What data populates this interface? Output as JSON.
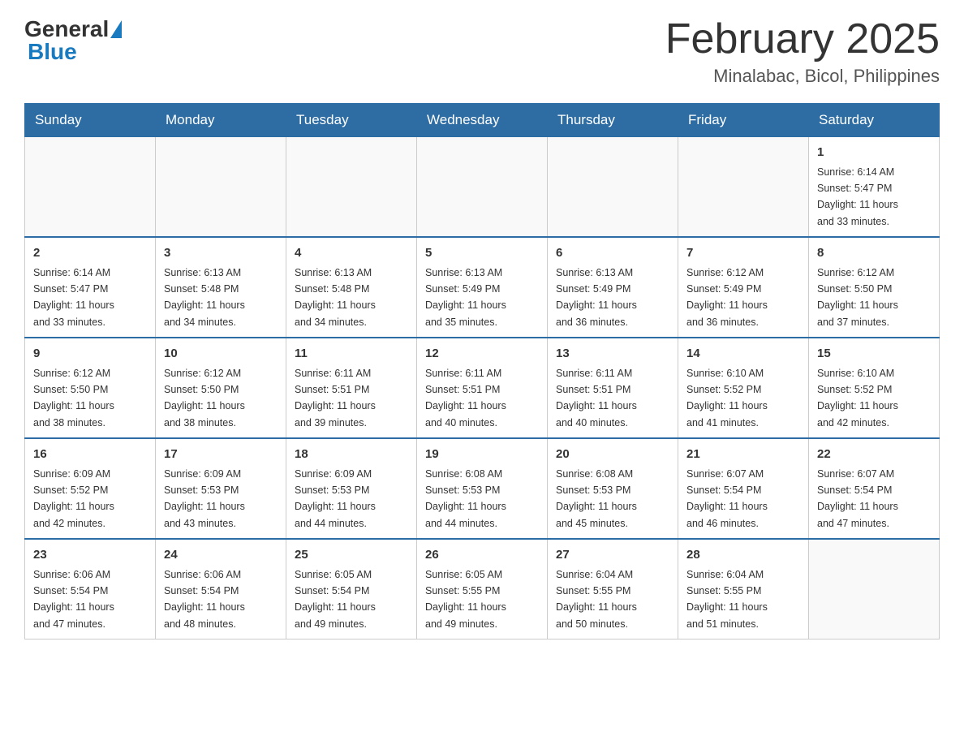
{
  "header": {
    "logo_general": "General",
    "logo_blue": "Blue",
    "main_title": "February 2025",
    "subtitle": "Minalabac, Bicol, Philippines"
  },
  "days_of_week": [
    "Sunday",
    "Monday",
    "Tuesday",
    "Wednesday",
    "Thursday",
    "Friday",
    "Saturday"
  ],
  "weeks": [
    [
      {
        "day": "",
        "info": ""
      },
      {
        "day": "",
        "info": ""
      },
      {
        "day": "",
        "info": ""
      },
      {
        "day": "",
        "info": ""
      },
      {
        "day": "",
        "info": ""
      },
      {
        "day": "",
        "info": ""
      },
      {
        "day": "1",
        "info": "Sunrise: 6:14 AM\nSunset: 5:47 PM\nDaylight: 11 hours\nand 33 minutes."
      }
    ],
    [
      {
        "day": "2",
        "info": "Sunrise: 6:14 AM\nSunset: 5:47 PM\nDaylight: 11 hours\nand 33 minutes."
      },
      {
        "day": "3",
        "info": "Sunrise: 6:13 AM\nSunset: 5:48 PM\nDaylight: 11 hours\nand 34 minutes."
      },
      {
        "day": "4",
        "info": "Sunrise: 6:13 AM\nSunset: 5:48 PM\nDaylight: 11 hours\nand 34 minutes."
      },
      {
        "day": "5",
        "info": "Sunrise: 6:13 AM\nSunset: 5:49 PM\nDaylight: 11 hours\nand 35 minutes."
      },
      {
        "day": "6",
        "info": "Sunrise: 6:13 AM\nSunset: 5:49 PM\nDaylight: 11 hours\nand 36 minutes."
      },
      {
        "day": "7",
        "info": "Sunrise: 6:12 AM\nSunset: 5:49 PM\nDaylight: 11 hours\nand 36 minutes."
      },
      {
        "day": "8",
        "info": "Sunrise: 6:12 AM\nSunset: 5:50 PM\nDaylight: 11 hours\nand 37 minutes."
      }
    ],
    [
      {
        "day": "9",
        "info": "Sunrise: 6:12 AM\nSunset: 5:50 PM\nDaylight: 11 hours\nand 38 minutes."
      },
      {
        "day": "10",
        "info": "Sunrise: 6:12 AM\nSunset: 5:50 PM\nDaylight: 11 hours\nand 38 minutes."
      },
      {
        "day": "11",
        "info": "Sunrise: 6:11 AM\nSunset: 5:51 PM\nDaylight: 11 hours\nand 39 minutes."
      },
      {
        "day": "12",
        "info": "Sunrise: 6:11 AM\nSunset: 5:51 PM\nDaylight: 11 hours\nand 40 minutes."
      },
      {
        "day": "13",
        "info": "Sunrise: 6:11 AM\nSunset: 5:51 PM\nDaylight: 11 hours\nand 40 minutes."
      },
      {
        "day": "14",
        "info": "Sunrise: 6:10 AM\nSunset: 5:52 PM\nDaylight: 11 hours\nand 41 minutes."
      },
      {
        "day": "15",
        "info": "Sunrise: 6:10 AM\nSunset: 5:52 PM\nDaylight: 11 hours\nand 42 minutes."
      }
    ],
    [
      {
        "day": "16",
        "info": "Sunrise: 6:09 AM\nSunset: 5:52 PM\nDaylight: 11 hours\nand 42 minutes."
      },
      {
        "day": "17",
        "info": "Sunrise: 6:09 AM\nSunset: 5:53 PM\nDaylight: 11 hours\nand 43 minutes."
      },
      {
        "day": "18",
        "info": "Sunrise: 6:09 AM\nSunset: 5:53 PM\nDaylight: 11 hours\nand 44 minutes."
      },
      {
        "day": "19",
        "info": "Sunrise: 6:08 AM\nSunset: 5:53 PM\nDaylight: 11 hours\nand 44 minutes."
      },
      {
        "day": "20",
        "info": "Sunrise: 6:08 AM\nSunset: 5:53 PM\nDaylight: 11 hours\nand 45 minutes."
      },
      {
        "day": "21",
        "info": "Sunrise: 6:07 AM\nSunset: 5:54 PM\nDaylight: 11 hours\nand 46 minutes."
      },
      {
        "day": "22",
        "info": "Sunrise: 6:07 AM\nSunset: 5:54 PM\nDaylight: 11 hours\nand 47 minutes."
      }
    ],
    [
      {
        "day": "23",
        "info": "Sunrise: 6:06 AM\nSunset: 5:54 PM\nDaylight: 11 hours\nand 47 minutes."
      },
      {
        "day": "24",
        "info": "Sunrise: 6:06 AM\nSunset: 5:54 PM\nDaylight: 11 hours\nand 48 minutes."
      },
      {
        "day": "25",
        "info": "Sunrise: 6:05 AM\nSunset: 5:54 PM\nDaylight: 11 hours\nand 49 minutes."
      },
      {
        "day": "26",
        "info": "Sunrise: 6:05 AM\nSunset: 5:55 PM\nDaylight: 11 hours\nand 49 minutes."
      },
      {
        "day": "27",
        "info": "Sunrise: 6:04 AM\nSunset: 5:55 PM\nDaylight: 11 hours\nand 50 minutes."
      },
      {
        "day": "28",
        "info": "Sunrise: 6:04 AM\nSunset: 5:55 PM\nDaylight: 11 hours\nand 51 minutes."
      },
      {
        "day": "",
        "info": ""
      }
    ]
  ]
}
